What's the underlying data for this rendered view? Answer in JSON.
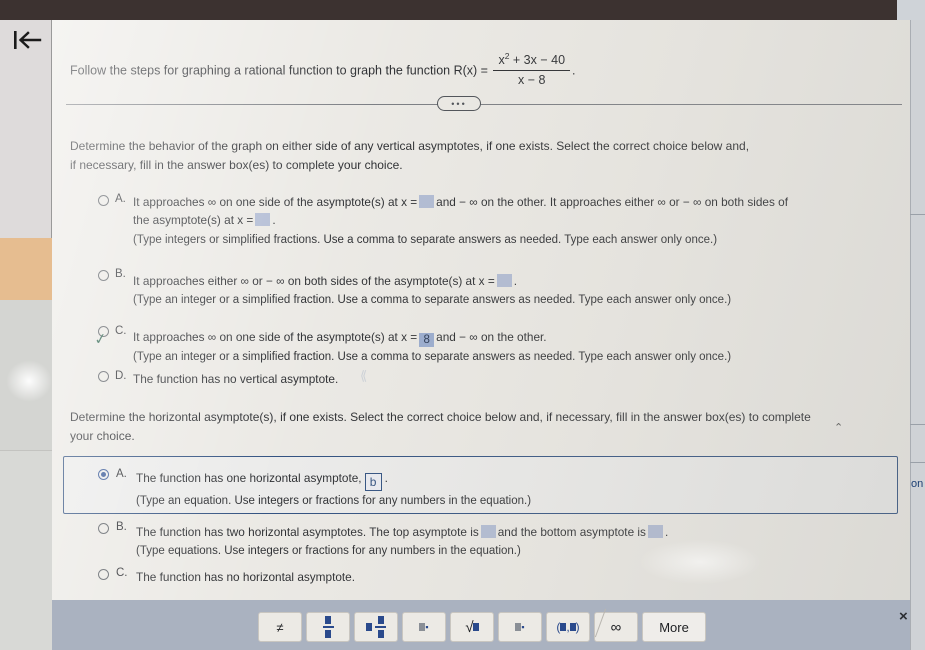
{
  "window": {
    "back_icon": "back-to-start-icon",
    "close_label": "×"
  },
  "header": {
    "instruction": "Follow the steps for graphing a rational function to graph the function R(x) =",
    "function_numerator": "x² + 3x − 40",
    "function_denominator": "x − 8",
    "function_trailing": ".",
    "divider_dots": "•••"
  },
  "question1": {
    "prompt_line1": "Determine the behavior of the graph on either side of any vertical asymptotes, if one exists. Select the correct choice below and,",
    "prompt_line2": "if necessary, fill in the answer box(es) to complete your choice.",
    "options": [
      {
        "letter": "A.",
        "selected": false,
        "text_part1": "It approaches ∞ on one side of the asymptote(s) at x =",
        "text_part2": "and − ∞ on the other. It approaches either ∞ or − ∞ on both sides of",
        "text_part3": "the asymptote(s) at x =",
        "text_part4": ".",
        "hint": "(Type integers or simplified fractions. Use a comma to separate answers as needed. Type each answer only once.)"
      },
      {
        "letter": "B.",
        "selected": false,
        "text_part1": "It approaches either ∞ or − ∞ on both sides of the asymptote(s) at x =",
        "text_part2": ".",
        "hint": "(Type an integer or a simplified fraction. Use a comma to separate answers as needed. Type each answer only once.)"
      },
      {
        "letter": "C.",
        "selected": true,
        "text_part1": "It approaches ∞ on one side of the asymptote(s) at x =",
        "answer_value": "8",
        "text_part2": "and − ∞ on the other.",
        "hint": "(Type an integer or a simplified fraction. Use a comma to separate answers as needed. Type each answer only once.)"
      },
      {
        "letter": "D.",
        "selected": false,
        "text_part1": "The function has no vertical asymptote.",
        "hint": ""
      }
    ]
  },
  "question2": {
    "prompt_line1": "Determine the horizontal asymptote(s), if one exists. Select the correct choice below and, if necessary, fill in the answer box(es) to complete",
    "prompt_line2": "your choice.",
    "options": [
      {
        "letter": "A.",
        "selected": true,
        "text_part1": "The function has one horizontal asymptote,",
        "input_value": "b",
        "text_part2": ".",
        "hint": "(Type an equation. Use integers or fractions for any numbers in the equation.)"
      },
      {
        "letter": "B.",
        "selected": false,
        "text_part1": "The function has two horizontal asymptotes. The top asymptote is",
        "text_part2": "and the bottom asymptote is",
        "text_part3": ".",
        "hint": "(Type equations. Use integers or fractions for any numbers in the equation.)"
      },
      {
        "letter": "C.",
        "selected": false,
        "text_part1": "The function has no horizontal asymptote.",
        "hint": ""
      }
    ]
  },
  "math_palette": {
    "buttons": [
      {
        "name": "not-equal-button",
        "label": "≠"
      },
      {
        "name": "fraction-button",
        "label": "fraction"
      },
      {
        "name": "mixed-number-button",
        "label": "mixed-number"
      },
      {
        "name": "exponent-button",
        "label": "exponent"
      },
      {
        "name": "square-root-button",
        "label": "√"
      },
      {
        "name": "subscript-button",
        "label": "subscript"
      },
      {
        "name": "interval-button",
        "label": "(▪,▪)"
      },
      {
        "name": "infinity-button",
        "label": "∞"
      },
      {
        "name": "more-button",
        "label": "More"
      }
    ]
  },
  "right_sliver": {
    "partial_text": "on"
  }
}
